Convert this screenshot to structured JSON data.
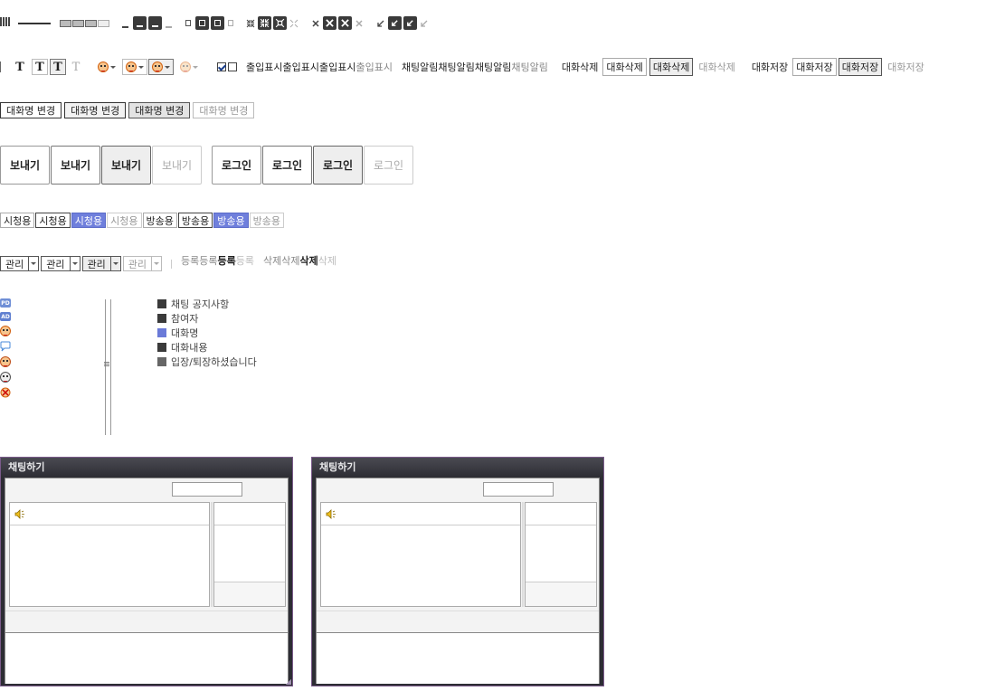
{
  "checkbox_label_sprite": [
    "출입표시",
    "출입표시",
    "출입표시",
    "출입표시"
  ],
  "alert_sprite": [
    "채팅알림",
    "채팅알림",
    "채팅알림",
    "채팅알림"
  ],
  "delete_chat": [
    "대화삭제",
    "대화삭제",
    "대화삭제",
    "대화삭제"
  ],
  "save_chat": [
    "대화저장",
    "대화저장",
    "대화저장",
    "대화저장"
  ],
  "text_tool_glyph": "T",
  "rename_buttons": [
    "대화명 변경",
    "대화명 변경",
    "대화명 변경",
    "대화명 변경"
  ],
  "send_buttons": [
    "보내기",
    "보내기",
    "보내기",
    "보내기"
  ],
  "login_buttons": [
    "로그인",
    "로그인",
    "로그인",
    "로그인"
  ],
  "listener_tags": [
    "시청용",
    "시청용",
    "시청용",
    "시청용"
  ],
  "broadcast_tags": [
    "방송용",
    "방송용",
    "방송용",
    "방송용"
  ],
  "manage_dropdowns": [
    "관리",
    "관리",
    "관리",
    "관리"
  ],
  "register_sprite": [
    "등록",
    "등록",
    "등록",
    "등록"
  ],
  "delete_sprite": [
    "삭제",
    "삭제",
    "삭제",
    "삭제"
  ],
  "side_icons": {
    "pd_badge": "PD",
    "ad_badge": "AD"
  },
  "legend": [
    {
      "label": "채팅 공지사항",
      "color": "#3a3a3a"
    },
    {
      "label": "참여자",
      "color": "#3a3a3a"
    },
    {
      "label": "대화명",
      "color": "#6a7ad8"
    },
    {
      "label": "대화내용",
      "color": "#3a3a3a"
    },
    {
      "label": "입장/퇴장하셨습니다",
      "color": "#666666"
    }
  ],
  "chat_panels": [
    {
      "title": "채팅하기"
    },
    {
      "title": "채팅하기"
    }
  ],
  "colors": {
    "selected_tag": "#6f7fdc",
    "panel_bg": "#2d2d34",
    "panel_border": "#7a5a8a"
  }
}
